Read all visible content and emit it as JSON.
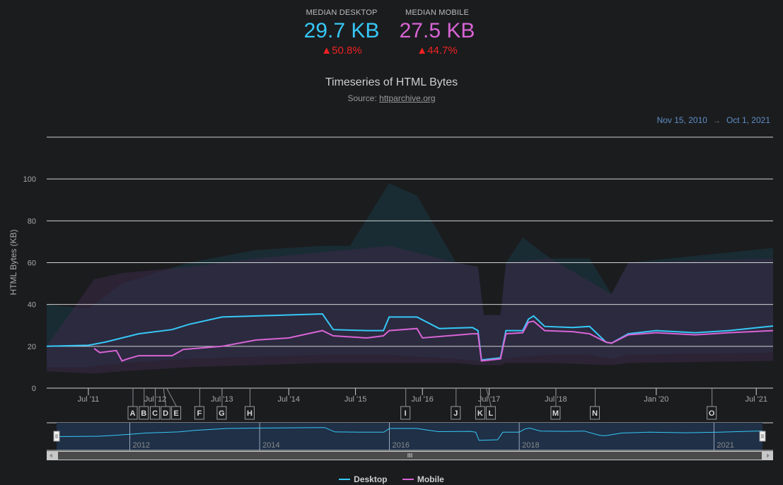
{
  "stats": {
    "desktop": {
      "label": "MEDIAN DESKTOP",
      "value": "29.7 KB",
      "change": "▲50.8%"
    },
    "mobile": {
      "label": "MEDIAN MOBILE",
      "value": "27.5 KB",
      "change": "▲44.7%"
    }
  },
  "header": {
    "title": "Timeseries of HTML Bytes",
    "source_prefix": "Source: ",
    "source_link": "httparchive.org"
  },
  "range": {
    "from": "Nov 15, 2010",
    "arrow": "→",
    "to": "Oct 1, 2021"
  },
  "colors": {
    "desktop": "#36c8f6",
    "mobile": "#d864d4",
    "background": "#1b1c1e",
    "navigator_fill": "#1f3047"
  },
  "chart_data": {
    "type": "line",
    "ylabel": "HTML Bytes (KB)",
    "ylim": [
      0,
      120
    ],
    "yticks": [
      0,
      20,
      40,
      60,
      80,
      100
    ],
    "xlim": [
      "2010-11-15",
      "2021-10-01"
    ],
    "xticks": [
      {
        "date": "2011-07-01",
        "label": "Jul '11"
      },
      {
        "date": "2012-07-01",
        "label": "Jul '12"
      },
      {
        "date": "2013-07-01",
        "label": "Jul '13"
      },
      {
        "date": "2014-07-01",
        "label": "Jul '14"
      },
      {
        "date": "2015-07-01",
        "label": "Jul '15"
      },
      {
        "date": "2016-07-01",
        "label": "Jul '16"
      },
      {
        "date": "2017-07-01",
        "label": "Jul '17"
      },
      {
        "date": "2018-07-01",
        "label": "Jul '18"
      },
      {
        "date": "2020-01-01",
        "label": "Jan '20"
      },
      {
        "date": "2021-07-01",
        "label": "Jul '21"
      }
    ],
    "grid": true,
    "legend_position": "bottom",
    "series": [
      {
        "name": "Desktop",
        "points": [
          [
            "2010-11-15",
            20
          ],
          [
            "2011-07-01",
            20.5
          ],
          [
            "2011-10-01",
            22
          ],
          [
            "2012-01-01",
            24
          ],
          [
            "2012-04-01",
            26
          ],
          [
            "2012-10-01",
            28
          ],
          [
            "2013-01-01",
            30.5
          ],
          [
            "2013-07-01",
            34
          ],
          [
            "2014-01-01",
            34.5
          ],
          [
            "2014-07-01",
            35
          ],
          [
            "2015-01-01",
            35.5
          ],
          [
            "2015-03-01",
            28
          ],
          [
            "2015-09-01",
            27.5
          ],
          [
            "2015-12-01",
            27.5
          ],
          [
            "2016-01-01",
            34
          ],
          [
            "2016-06-01",
            34
          ],
          [
            "2016-10-01",
            28.5
          ],
          [
            "2017-04-01",
            29
          ],
          [
            "2017-05-01",
            27.5
          ],
          [
            "2017-05-20",
            13.5
          ],
          [
            "2017-09-01",
            14.5
          ],
          [
            "2017-10-01",
            27.5
          ],
          [
            "2018-01-01",
            27.5
          ],
          [
            "2018-02-01",
            33
          ],
          [
            "2018-03-01",
            34.5
          ],
          [
            "2018-05-01",
            29.5
          ],
          [
            "2018-10-01",
            29
          ],
          [
            "2019-01-01",
            29.5
          ],
          [
            "2019-04-01",
            22
          ],
          [
            "2019-05-01",
            21.5
          ],
          [
            "2019-08-01",
            26
          ],
          [
            "2020-01-01",
            27.5
          ],
          [
            "2020-08-01",
            26.5
          ],
          [
            "2021-02-01",
            27.5
          ],
          [
            "2021-10-01",
            29.7
          ]
        ],
        "band": [
          [
            "2010-11-15",
            10,
            40
          ],
          [
            "2011-07-01",
            10,
            38
          ],
          [
            "2012-01-01",
            12,
            50
          ],
          [
            "2013-01-01",
            14,
            60
          ],
          [
            "2014-01-01",
            15,
            66
          ],
          [
            "2015-01-01",
            16,
            68
          ],
          [
            "2015-06-01",
            16,
            68
          ],
          [
            "2016-01-01",
            16,
            98
          ],
          [
            "2016-06-01",
            15,
            92
          ],
          [
            "2017-01-01",
            14,
            60
          ],
          [
            "2017-05-01",
            13,
            58
          ],
          [
            "2017-06-01",
            13,
            35
          ],
          [
            "2017-09-01",
            13,
            35
          ],
          [
            "2017-10-01",
            14,
            60
          ],
          [
            "2018-01-01",
            15,
            72
          ],
          [
            "2018-06-01",
            16,
            62
          ],
          [
            "2019-01-01",
            16,
            62
          ],
          [
            "2019-05-01",
            14,
            45
          ],
          [
            "2019-08-01",
            16,
            60
          ],
          [
            "2021-10-01",
            17,
            67
          ]
        ]
      },
      {
        "name": "Mobile",
        "points": [
          [
            "2011-08-01",
            19
          ],
          [
            "2011-09-01",
            17
          ],
          [
            "2011-12-01",
            18
          ],
          [
            "2012-01-01",
            13
          ],
          [
            "2012-02-01",
            14
          ],
          [
            "2012-04-01",
            15.5
          ],
          [
            "2012-10-01",
            15.5
          ],
          [
            "2012-12-01",
            18.5
          ],
          [
            "2013-07-01",
            20
          ],
          [
            "2014-01-01",
            23
          ],
          [
            "2014-07-01",
            24
          ],
          [
            "2015-01-01",
            27.5
          ],
          [
            "2015-03-01",
            25
          ],
          [
            "2015-09-01",
            24
          ],
          [
            "2015-12-01",
            25
          ],
          [
            "2016-01-01",
            27.5
          ],
          [
            "2016-06-01",
            28.5
          ],
          [
            "2016-07-01",
            24
          ],
          [
            "2017-04-01",
            26
          ],
          [
            "2017-05-01",
            26
          ],
          [
            "2017-05-20",
            13
          ],
          [
            "2017-09-01",
            14
          ],
          [
            "2017-10-01",
            26
          ],
          [
            "2018-01-01",
            26.5
          ],
          [
            "2018-02-01",
            31.5
          ],
          [
            "2018-03-01",
            32
          ],
          [
            "2018-05-01",
            27.5
          ],
          [
            "2018-10-01",
            27
          ],
          [
            "2019-01-01",
            26
          ],
          [
            "2019-04-01",
            22
          ],
          [
            "2019-05-01",
            21.5
          ],
          [
            "2019-08-01",
            25.5
          ],
          [
            "2020-01-01",
            26.5
          ],
          [
            "2020-08-01",
            25.5
          ],
          [
            "2021-02-01",
            26.5
          ],
          [
            "2021-10-01",
            27.5
          ]
        ],
        "band": [
          [
            "2010-11-15",
            8,
            20
          ],
          [
            "2011-08-01",
            7,
            52
          ],
          [
            "2012-01-01",
            8,
            55
          ],
          [
            "2013-01-01",
            10,
            58
          ],
          [
            "2014-01-01",
            11,
            62
          ],
          [
            "2015-01-01",
            12,
            65
          ],
          [
            "2016-01-01",
            12,
            68
          ],
          [
            "2017-01-01",
            12,
            60
          ],
          [
            "2017-05-01",
            11,
            58
          ],
          [
            "2017-06-01",
            11,
            35
          ],
          [
            "2017-09-01",
            11,
            35
          ],
          [
            "2017-10-01",
            12,
            60
          ],
          [
            "2018-06-01",
            12,
            62
          ],
          [
            "2019-05-01",
            11,
            45
          ],
          [
            "2019-08-01",
            12,
            60
          ],
          [
            "2021-10-01",
            13,
            62
          ]
        ]
      }
    ],
    "annotations": [
      {
        "label": "A",
        "date": "2012-03-01"
      },
      {
        "label": "B",
        "date": "2012-05-01"
      },
      {
        "label": "C",
        "date": "2012-07-01"
      },
      {
        "label": "D",
        "date": "2012-08-15"
      },
      {
        "label": "E",
        "date": "2012-09-01"
      },
      {
        "label": "F",
        "date": "2013-03-01"
      },
      {
        "label": "G",
        "date": "2013-07-01"
      },
      {
        "label": "H",
        "date": "2013-12-01"
      },
      {
        "label": "I",
        "date": "2016-04-01"
      },
      {
        "label": "J",
        "date": "2017-01-01"
      },
      {
        "label": "K",
        "date": "2017-05-15"
      },
      {
        "label": "L",
        "date": "2017-06-15"
      },
      {
        "label": "M",
        "date": "2018-07-01"
      },
      {
        "label": "N",
        "date": "2019-02-01"
      },
      {
        "label": "O",
        "date": "2020-11-01"
      }
    ],
    "navigator": {
      "labels": [
        {
          "date": "2012-01-01",
          "label": "2012"
        },
        {
          "date": "2014-01-01",
          "label": "2014"
        },
        {
          "date": "2016-01-01",
          "label": "2016"
        },
        {
          "date": "2018-01-01",
          "label": "2018"
        },
        {
          "date": "2021-01-01",
          "label": "2021"
        }
      ],
      "range": [
        "2010-11-15",
        "2021-10-01"
      ]
    }
  }
}
